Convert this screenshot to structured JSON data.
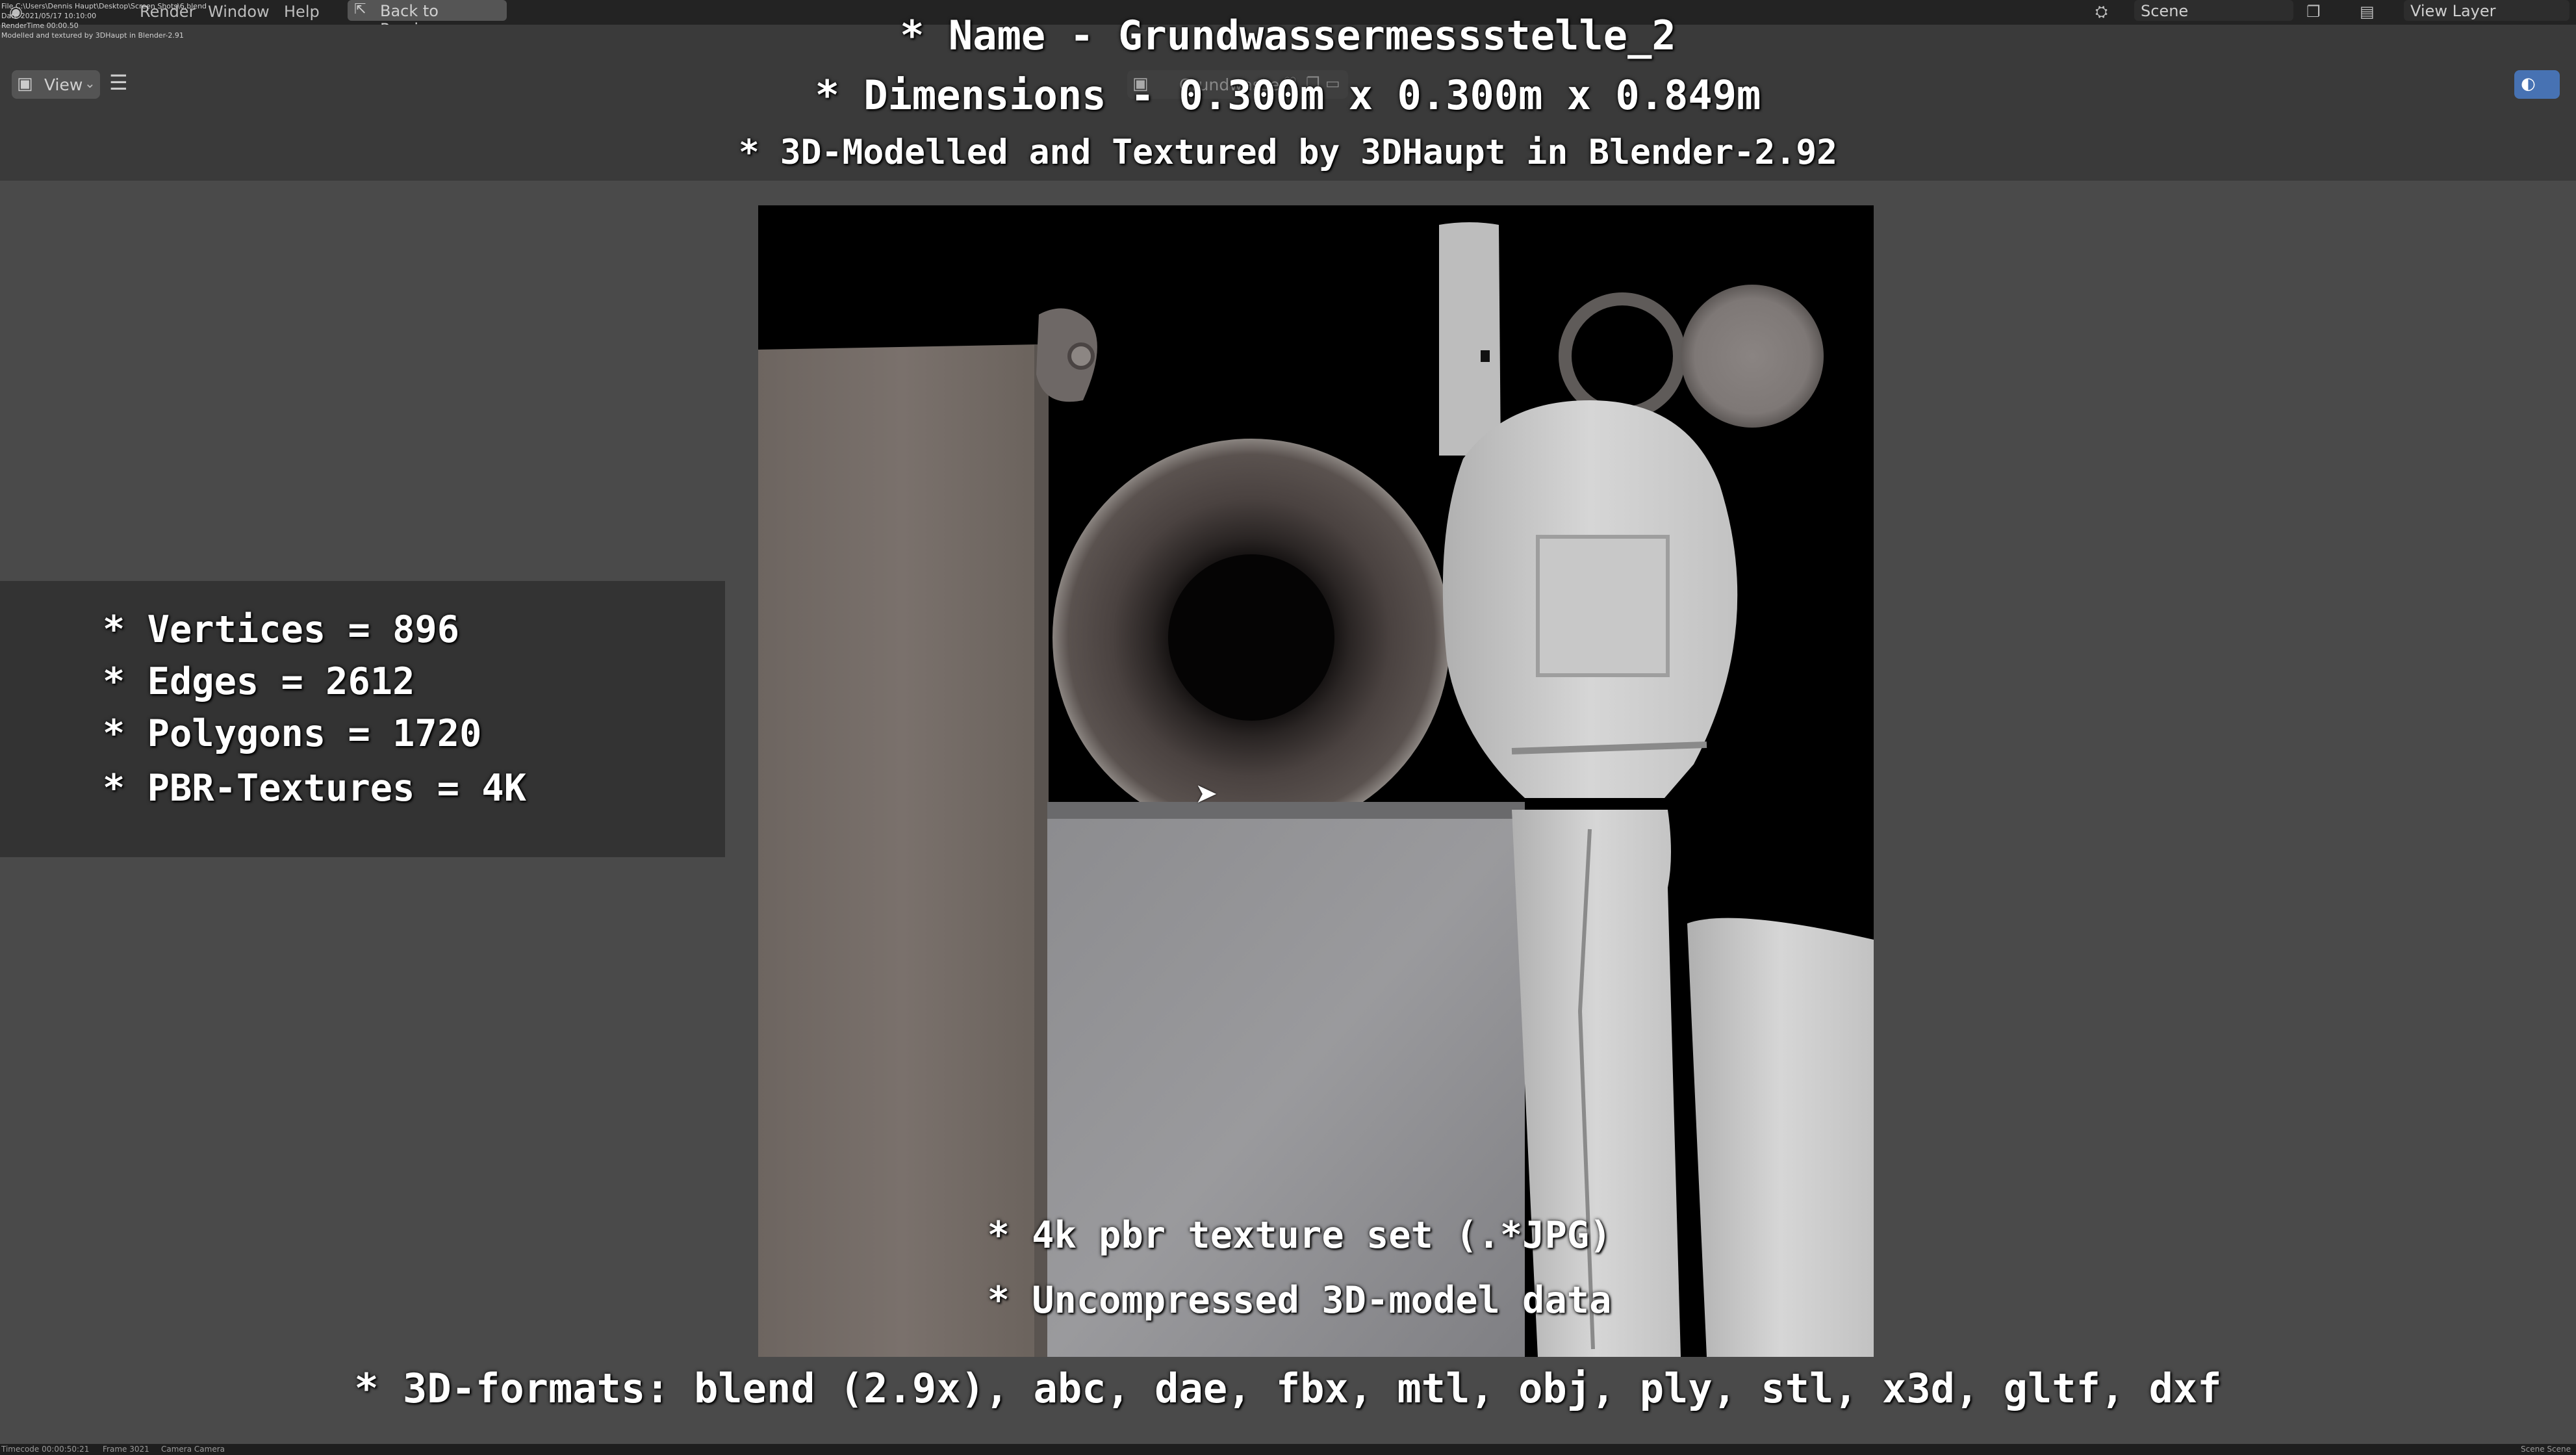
{
  "topbar": {
    "menu_render": "Render",
    "menu_window": "Window",
    "menu_help": "Help",
    "back_button": "Back to Previous",
    "scene": "Scene",
    "view_layer": "View Layer"
  },
  "file_info": {
    "file": "File C:\\Users\\Dennis Haupt\\Desktop\\Screen Shots\\6.blend",
    "date": "Date 2021/05/17 10:10:00",
    "render_time": "RenderTime 00:00.50",
    "note": "Modelled and textured by 3DHaupt in Blender-2.91"
  },
  "view_header": {
    "view_label": "View",
    "image_name": "Grundwasser"
  },
  "overlay": {
    "name_line": "* Name - Grundwassermessstelle_2",
    "dimensions_line": "* Dimensions -  0.300m x 0.300m x 0.849m",
    "credit_line": "* 3D-Modelled and Textured by 3DHaupt in Blender-2.92",
    "texture_line": "* 4k pbr texture set (.*JPG)",
    "uncompressed_line": "* Uncompressed 3D-model data",
    "formats_line": "* 3D-formats: blend (2.9x), abc, dae, fbx, mtl, obj, ply, stl, x3d, gltf, dxf"
  },
  "stats": {
    "vertices": "* Vertices = 896",
    "edges": "* Edges = 2612",
    "polygons": "* Polygons = 1720",
    "textures": "* PBR-Textures = 4K"
  },
  "statusbar": {
    "timecode": "Timecode 00:00:50:21",
    "frame": "Frame 3021",
    "camera": "Camera Camera",
    "scene": "Scene Scene"
  },
  "colors": {
    "background": "#4a4a4a",
    "header": "#3a3a3a",
    "topbar": "#232323",
    "stats_panel": "#333333",
    "render_bg": "#000000"
  },
  "icons": [
    "blender-icon",
    "image-icon",
    "hamburger-icon",
    "cursor-arrow-icon",
    "scene-icon",
    "view-layer-icon"
  ]
}
